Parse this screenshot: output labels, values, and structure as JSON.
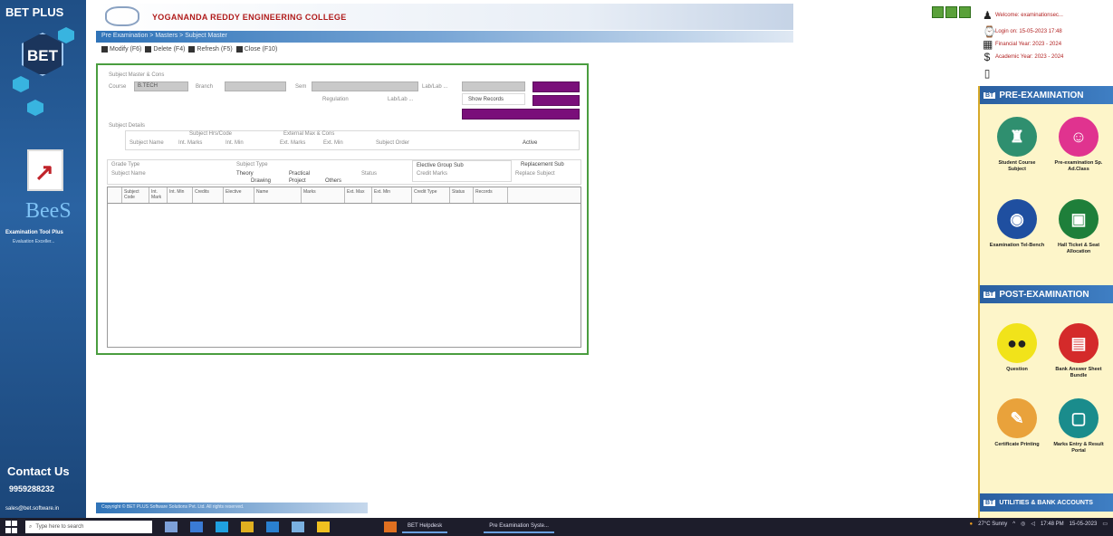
{
  "sidebar": {
    "brand": "BET PLUS",
    "logo_text": "BET",
    "bees": "BeeS",
    "bees_sub1": "Examination Tool Plus",
    "bees_sub2": "Evaluation Exceller...",
    "contact_label": "Contact Us",
    "phone": "9959288232",
    "email": "sales@bet.software.in"
  },
  "header": {
    "college_name": "YOGANANDA REDDY ENGINEERING COLLEGE",
    "breadcrumb": "Pre Examination > Masters > Subject Master"
  },
  "toolbar": {
    "items": [
      "Modify (F6)",
      "Delete (F4)",
      "Refresh (F5)",
      "Close (F10)"
    ]
  },
  "form": {
    "section1_label": "Subject Master & Cons",
    "course_label": "Course",
    "course_value": "B.TECH",
    "branch_label": "Branch",
    "sem_label": "Sem",
    "lab_label": "Lab/Lab ...",
    "regulation_label": "Regulation",
    "show_records": "Show Records",
    "section2_label": "Subject Details",
    "sub_hdr_a": "Subject Hrs/Code",
    "sub_hdr_b": "External Max & Cons",
    "subject_name_label": "Subject Name",
    "int_marks": "Int. Marks",
    "int_min": "Int. Min",
    "ext_marks": "Ext. Marks",
    "ext_min": "Ext. Min",
    "subject_order": "Subject Order",
    "status_label": "Status",
    "status_value": "Active",
    "subject_type": "Subject Type",
    "type_theory": "Theory",
    "type_drawing": "Drawing",
    "type_practical": "Practical",
    "type_project": "Project",
    "type_others": "Others",
    "grade_type": "Grade Type",
    "elective_hdr": "Elective Group Sub",
    "elective_type": "Credit Marks",
    "replacement": "Replacement Sub",
    "replace_sub": "Replace Subject",
    "grid_columns": [
      "",
      "Subject Code",
      "Int. Mark",
      "Int. Min",
      "Credits",
      "Elective",
      "Name",
      "Marks",
      "Ext. Max",
      "Ext. Min",
      "Credit Type",
      "Status",
      "Records"
    ]
  },
  "user": {
    "name": "Welcome: examinationsec...",
    "login": "Login on: 15-05-2023 17:48",
    "financial": "Financial Year: 2023 - 2024",
    "academic": "Academic Year: 2023 - 2024"
  },
  "right_sidebar": {
    "pre_title": "PRE-EXAMINATION",
    "post_title": "POST-EXAMINATION",
    "utilities_title": "UTILITIES & BANK ACCOUNTS",
    "pre_tiles": [
      "Student Course Subject",
      "Pre-examination Sp. Ad.Class",
      "Examination Tel-Bench",
      "Hall Ticket & Seat Allocation"
    ],
    "post_tiles": [
      "Question",
      "Bank Answer Sheet Bundle",
      "Certificate Printing",
      "Marks Entry & Result Portal"
    ]
  },
  "footer": {
    "text": "Copyright © BET PLUS Software Solutions Pvt. Ltd. All rights reserved."
  },
  "taskbar": {
    "search_placeholder": "Type here to search",
    "win1": "BET Helpdesk",
    "win2": "Pre Examination Syste...",
    "weather": "27°C Sunny",
    "time": "17:48 PM",
    "date": "15-05-2023"
  },
  "colors": {
    "sidebar": "#1f4f86",
    "panel_border": "#4a9d3f",
    "purple_button": "#7a0f7a",
    "right_panel": "#fdf5c9",
    "header_blue": "#2a5fa0"
  }
}
